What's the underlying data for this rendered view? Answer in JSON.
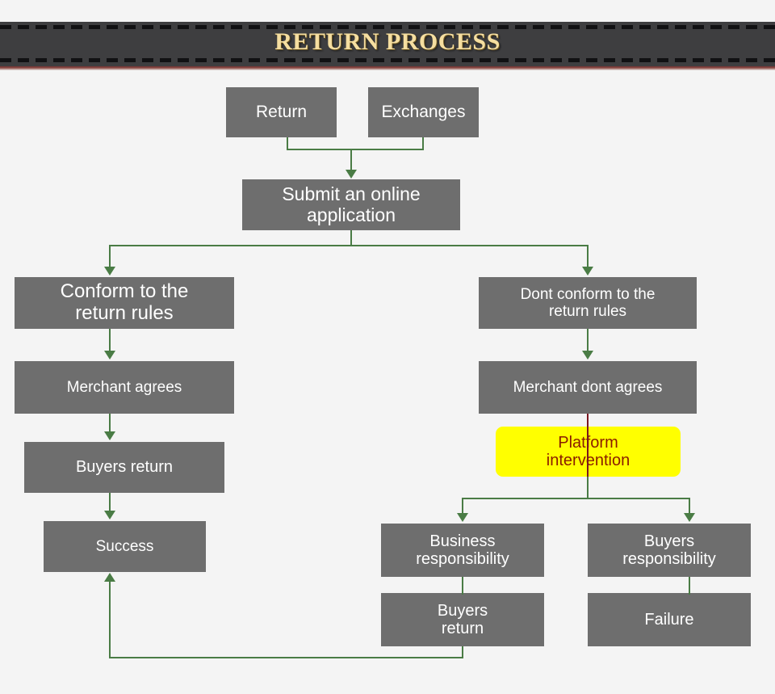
{
  "banner": {
    "title": "RETURN PROCESS",
    "background_color": "#3e3e40",
    "title_color": "#f5dea0",
    "underline_color": "#8d4a44"
  },
  "theme": {
    "canvas_color": "#f4f4f4",
    "node_color": "#6e6e6e",
    "node_text_color": "#ffffff",
    "highlight_node_color": "#ffff00",
    "highlight_text_color": "#8a1c00",
    "connector_color": "#4a7c45",
    "red_connector_color": "#7b1620"
  },
  "nodes": {
    "return": "Return",
    "exchanges": "Exchanges",
    "submit": "Submit an online\napplication",
    "conform": "Conform to the\nreturn rules",
    "dont_conform": "Dont conform to the\nreturn rules",
    "merchant_agrees": "Merchant agrees",
    "merchant_dont_agrees": "Merchant dont agrees",
    "buyers_return_left": "Buyers return",
    "platform_intervention": "Platform\nintervention",
    "success": "Success",
    "business_responsibility": "Business\nresponsibility",
    "buyers_responsibility": "Buyers\nresponsibility",
    "buyers_return_bottom": "Buyers\nreturn",
    "failure": "Failure"
  },
  "chart_data": {
    "type": "diagram",
    "title": "RETURN PROCESS",
    "diagram_kind": "flowchart",
    "orientation": "top-down",
    "nodes": [
      {
        "id": "return",
        "label": "Return",
        "style": "gray"
      },
      {
        "id": "exchanges",
        "label": "Exchanges",
        "style": "gray"
      },
      {
        "id": "submit",
        "label": "Submit an online application",
        "style": "gray"
      },
      {
        "id": "conform",
        "label": "Conform to the return rules",
        "style": "gray"
      },
      {
        "id": "dont_conform",
        "label": "Dont conform to the return rules",
        "style": "gray"
      },
      {
        "id": "merchant_agrees",
        "label": "Merchant agrees",
        "style": "gray"
      },
      {
        "id": "merchant_dont_agrees",
        "label": "Merchant dont agrees",
        "style": "gray"
      },
      {
        "id": "buyers_return_left",
        "label": "Buyers return",
        "style": "gray"
      },
      {
        "id": "platform_intervention",
        "label": "Platform intervention",
        "style": "yellow-rounded"
      },
      {
        "id": "success",
        "label": "Success",
        "style": "gray"
      },
      {
        "id": "business_responsibility",
        "label": "Business responsibility",
        "style": "gray"
      },
      {
        "id": "buyers_responsibility",
        "label": "Buyers responsibility",
        "style": "gray"
      },
      {
        "id": "buyers_return_bottom",
        "label": "Buyers return",
        "style": "gray"
      },
      {
        "id": "failure",
        "label": "Failure",
        "style": "gray"
      }
    ],
    "edges": [
      {
        "from": "return",
        "to": "submit",
        "color": "#4a7c45"
      },
      {
        "from": "exchanges",
        "to": "submit",
        "color": "#4a7c45"
      },
      {
        "from": "submit",
        "to": "conform",
        "color": "#4a7c45"
      },
      {
        "from": "submit",
        "to": "dont_conform",
        "color": "#4a7c45"
      },
      {
        "from": "conform",
        "to": "merchant_agrees",
        "color": "#4a7c45"
      },
      {
        "from": "merchant_agrees",
        "to": "buyers_return_left",
        "color": "#4a7c45"
      },
      {
        "from": "buyers_return_left",
        "to": "success",
        "color": "#4a7c45"
      },
      {
        "from": "dont_conform",
        "to": "merchant_dont_agrees",
        "color": "#4a7c45"
      },
      {
        "from": "merchant_dont_agrees",
        "to": "platform_intervention",
        "color": "#7b1620"
      },
      {
        "from": "platform_intervention",
        "to": "business_responsibility",
        "color": "#4a7c45"
      },
      {
        "from": "platform_intervention",
        "to": "buyers_responsibility",
        "color": "#4a7c45"
      },
      {
        "from": "business_responsibility",
        "to": "buyers_return_bottom",
        "color": "#4a7c45"
      },
      {
        "from": "buyers_responsibility",
        "to": "failure",
        "color": "#4a7c45"
      },
      {
        "from": "buyers_return_bottom",
        "to": "success",
        "color": "#4a7c45"
      }
    ]
  }
}
